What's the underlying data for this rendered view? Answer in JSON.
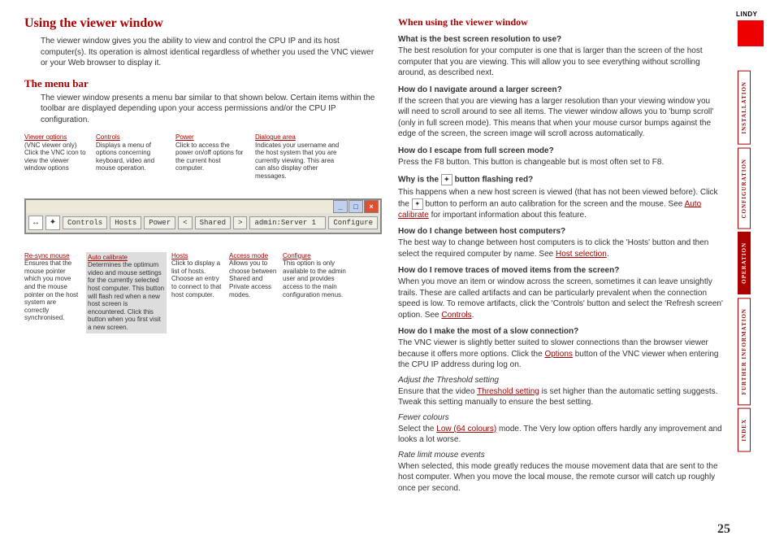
{
  "page_number": "25",
  "brand": "LINDY",
  "left": {
    "title": "Using the viewer window",
    "intro": "The viewer window gives you the ability to view and control the CPU IP and its host computer(s). Its operation is almost identical regardless of whether you used the VNC viewer or your Web browser to display it.",
    "menu_heading": "The menu bar",
    "menu_intro": "The viewer window presents a menu bar similar to that shown below. Certain items within the toolbar are displayed depending upon your access permissions and/or the CPU IP configuration."
  },
  "callouts_top": [
    {
      "label": "Viewer options",
      "text": "(VNC viewer only) Click the VNC icon to view the viewer window options"
    },
    {
      "label": "Controls",
      "text": "Displays a menu of options concerning keyboard, video and mouse operation."
    },
    {
      "label": "Power",
      "text": "Click to access the power on/off options for the current host computer."
    },
    {
      "label": "Dialogue area",
      "text": "Indicates your username and the host system that you are currently viewing. This area can also display other messages."
    }
  ],
  "toolbar": {
    "controls": "Controls",
    "hosts": "Hosts",
    "power": "Power",
    "shared": "Shared",
    "admin": "admin:Server 1",
    "configure": "Configure"
  },
  "callouts_bottom": [
    {
      "label": "Re-sync mouse",
      "text": "Ensures that the mouse pointer which you move and the mouse pointer on the host system are correctly synchronised."
    },
    {
      "label": "Auto calibrate",
      "text": "Determines the optimum video and mouse settings for the currently selected host computer. This button will flash red when a new host screen is encountered. Click this button when you first visit a new screen."
    },
    {
      "label": "Hosts",
      "text": "Click to display a list of hosts. Choose an entry to connect to that host computer."
    },
    {
      "label": "Access mode",
      "text": "Allows you to choose between Shared and Private access modes."
    },
    {
      "label": "Configure",
      "text": "This option is only available to the admin user and provides access to the main configuration menus."
    }
  ],
  "right": {
    "heading": "When using the viewer window",
    "q1": "What is the best screen resolution to use?",
    "a1": "The best resolution for your computer is one that is larger than the screen of the host computer that you are viewing. This will allow you to see everything without scrolling around, as described next.",
    "q2": "How do I navigate around a larger screen?",
    "a2": "If the screen that you are viewing has a larger resolution than your viewing window you will need to scroll around to see all items. The viewer window allows you to 'bump scroll' (only in full screen mode). This means that when your mouse cursor bumps against the edge of the screen, the screen image will scroll across automatically.",
    "q3": "How do I escape from full screen mode?",
    "a3": "Press the F8 button. This button is changeable but is most often set to F8.",
    "q4a": "Why is the ",
    "q4b": " button flashing red?",
    "a4a": "This happens when a new host screen is viewed (that has not been viewed before). Click the ",
    "a4b": " button to perform an auto calibration for the screen and the mouse. See ",
    "a4link": "Auto calibrate",
    "a4c": " for important information about this feature.",
    "q5": "How do I change between host computers?",
    "a5a": "The best way to change between host computers is to click the 'Hosts' button and then select the required computer by name. See ",
    "a5link": "Host selection",
    "a5b": ".",
    "q6": "How do I remove traces of moved items from the screen?",
    "a6a": "When you move an item or window across the screen, sometimes it can leave unsightly trails. These are called artifacts and can be particularly prevalent when the connection speed is low. To remove artifacts, click the 'Controls' button and select the 'Refresh screen' option. See ",
    "a6link": "Controls",
    "a6b": ".",
    "q7": "How do I make the most of a slow connection?",
    "a7a": "The VNC viewer is slightly better suited to slower connections than the browser viewer because it offers more options. Click the ",
    "a7link": "Options",
    "a7b": " button of the VNC viewer when entering the CPU IP address during log on.",
    "s1": "Adjust the Threshold setting",
    "s1a": "Ensure that the video ",
    "s1link": "Threshold setting",
    "s1b": " is set higher than the automatic setting suggests. Tweak this setting manually to ensure the best setting.",
    "s2": "Fewer colours",
    "s2a": "Select the ",
    "s2link": "Low (64 colours)",
    "s2b": " mode. The Very low option offers hardly any improvement and looks a lot worse.",
    "s3": "Rate limit mouse events",
    "s3t": "When selected, this mode greatly reduces the mouse movement data that are sent to the host computer. When you move the local mouse, the remote cursor will catch up roughly once per second."
  },
  "tabs": {
    "installation": "INSTALLATION",
    "configuration": "CONFIGURATION",
    "operation": "OPERATION",
    "further": "FURTHER INFORMATION",
    "index": "INDEX"
  }
}
